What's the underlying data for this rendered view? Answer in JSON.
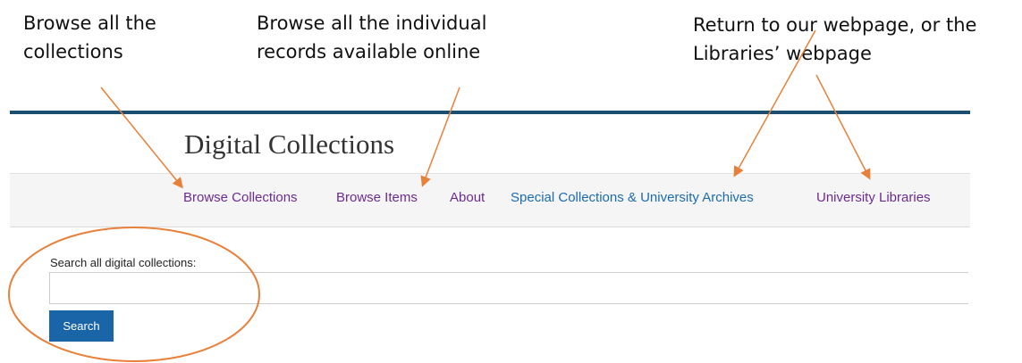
{
  "callouts": {
    "browse_collections": "Browse all the\ncollections",
    "browse_items": "Browse all the individual\nrecords available online",
    "webpages": "Return to our webpage, or the\nLibraries’ webpage"
  },
  "header": {
    "title": "Digital Collections"
  },
  "nav": {
    "browse_collections": "Browse Collections",
    "browse_items": "Browse Items",
    "about": "About",
    "special_collections": "Special Collections & University Archives",
    "university_libraries": "University Libraries"
  },
  "search": {
    "label": "Search all digital collections:",
    "value": "",
    "placeholder": "",
    "button_label": "Search"
  },
  "colors": {
    "annotation": "#e8803a",
    "top_rule": "#1c4e72",
    "nav_visited": "#6b2c91",
    "nav_link": "#1c6bb0",
    "button": "#1a64a8"
  }
}
